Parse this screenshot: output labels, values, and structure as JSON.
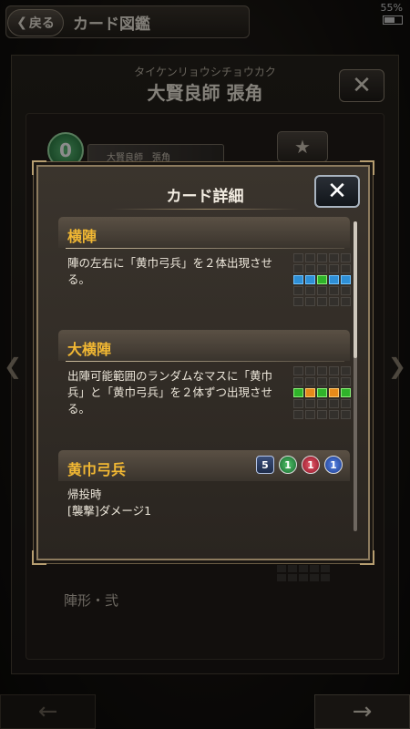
{
  "status": {
    "battery": "55%"
  },
  "topbar": {
    "back_label": "戻る",
    "title": "カード図鑑"
  },
  "card": {
    "furigana": "タイケンリョウシチョウカク",
    "name": "大賢良師 張角",
    "cost": "0",
    "mini_name": "大賢良師　張角"
  },
  "background": {
    "section_label": "陣形・弐"
  },
  "modal": {
    "title": "カード詳細",
    "skills": [
      {
        "name": "横陣",
        "description": "陣の左右に「黄巾弓兵」を２体出現させる。"
      },
      {
        "name": "大横陣",
        "description": "出陣可能範囲のランダムなマスに「黄巾兵」と「黄巾弓兵」を２体ずつ出現させる。"
      }
    ],
    "unit": {
      "name": "黄巾弓兵",
      "cost": "5",
      "stats": [
        "1",
        "1",
        "1"
      ],
      "trigger": "帰投時",
      "effect": "[襲撃]ダメージ1"
    }
  },
  "colors": {
    "accent": "#f2b833",
    "formation_blue": "#2e8fd6",
    "formation_green": "#2fb32a",
    "formation_orange": "#e68a1a"
  }
}
